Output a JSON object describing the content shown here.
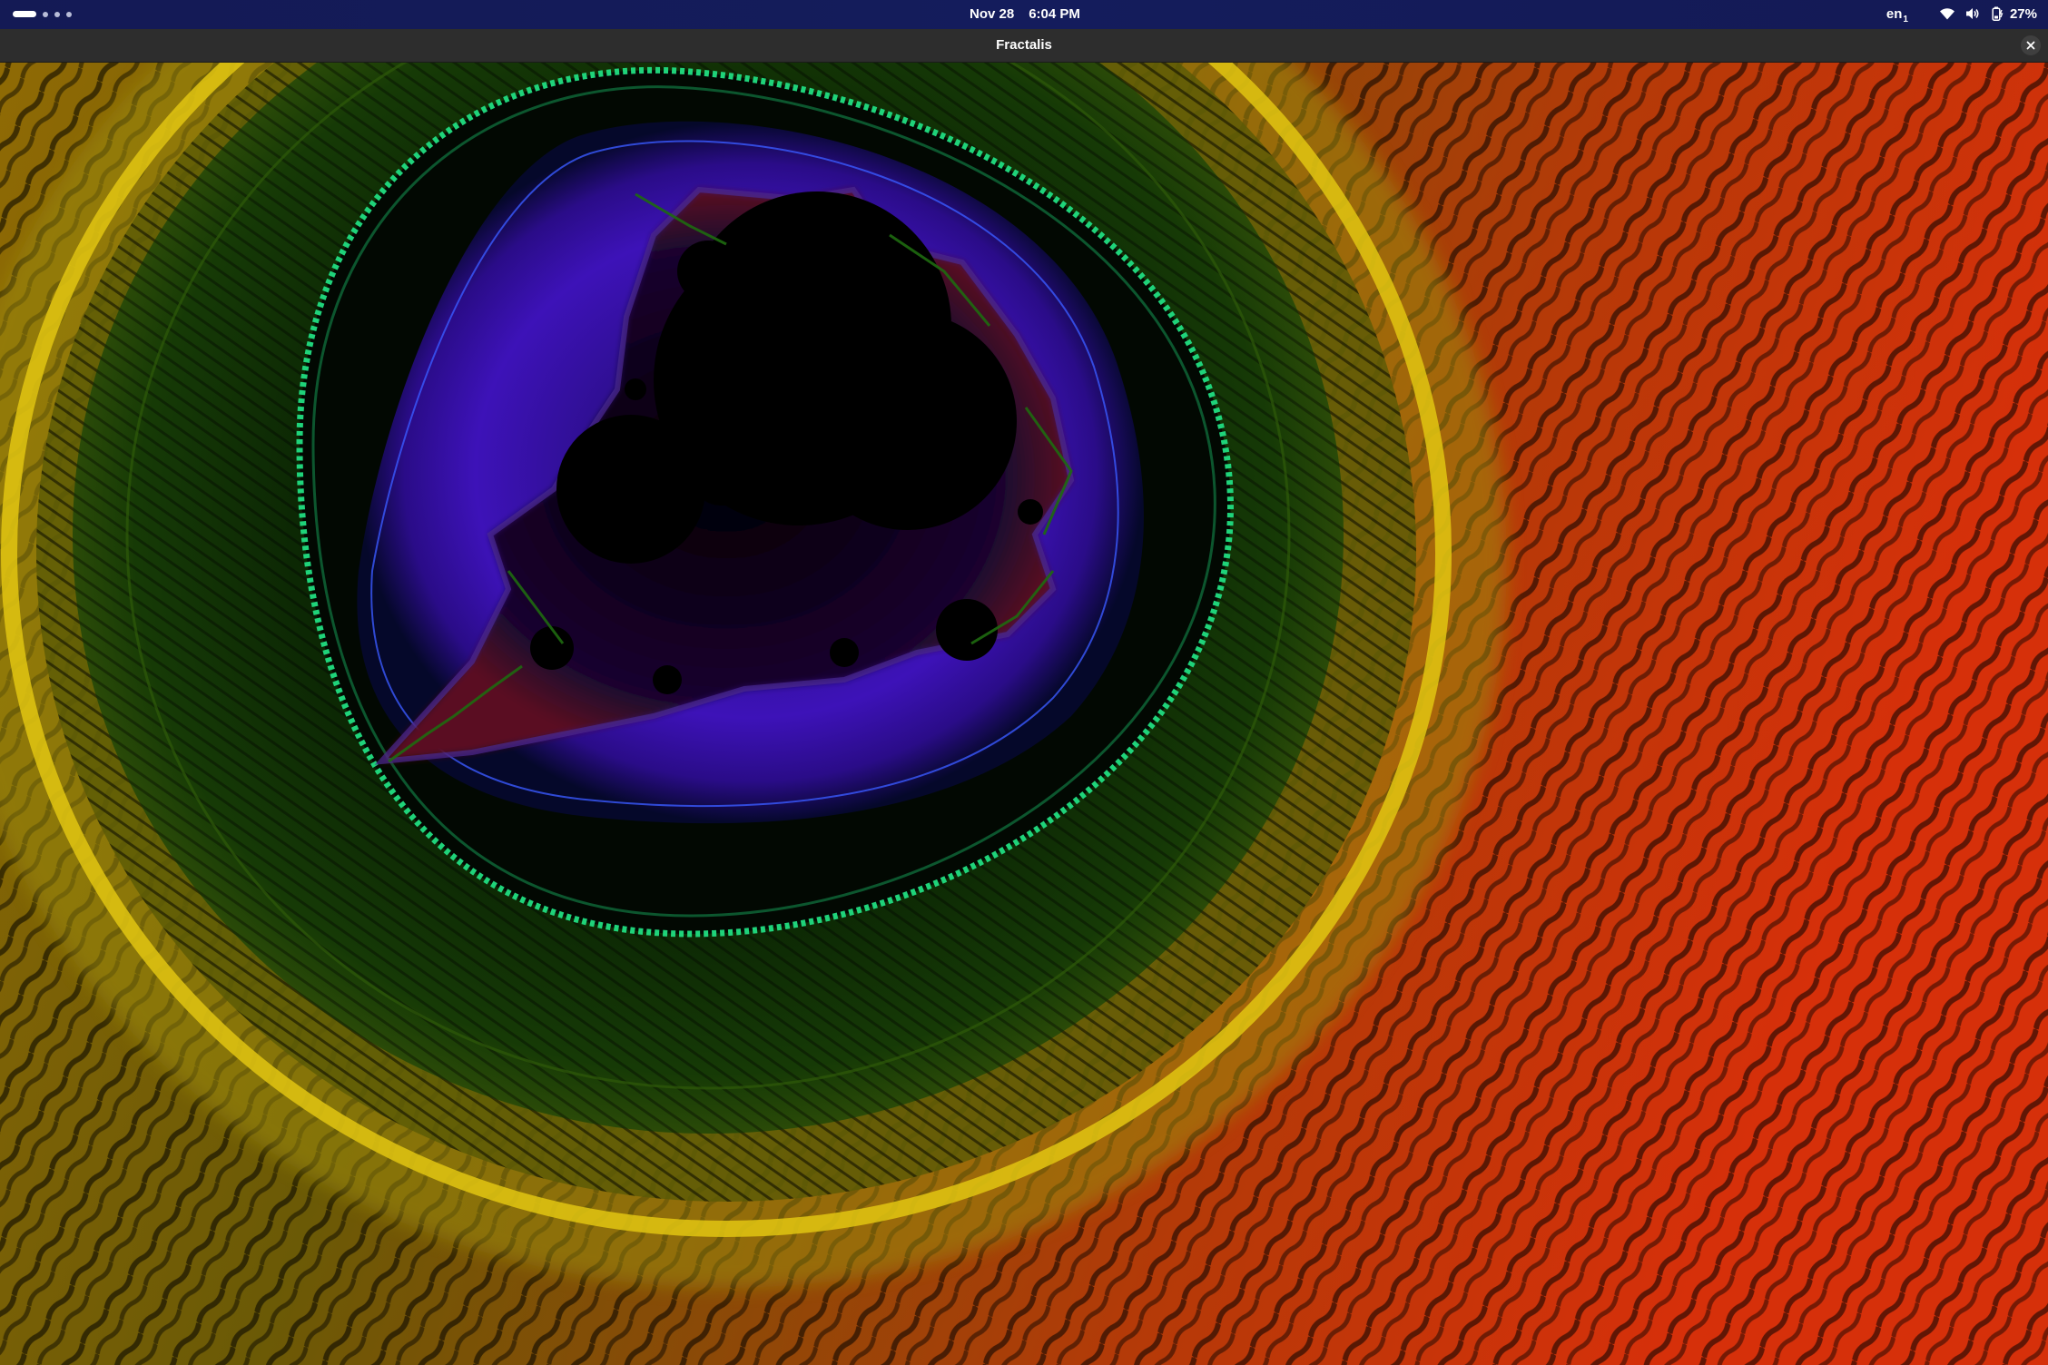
{
  "topbar": {
    "date": "Nov 28",
    "time": "6:04 PM",
    "language": "en",
    "language_sub": "1",
    "battery_percent": "27%",
    "workspace_count": 4,
    "active_workspace": 1,
    "icons": [
      "wifi-icon",
      "volume-icon",
      "battery-icon"
    ]
  },
  "window": {
    "title": "Fractalis",
    "close_icon": "close-icon"
  },
  "fractal": {
    "type": "mandelbrot",
    "palette": {
      "interior": "#000000",
      "halo_blue": "#3a14b8",
      "green_ring": "#1fd37a",
      "dark_green": "#0c2a05",
      "yellow_ring": "#e2c512",
      "orange": "#f07a1a",
      "red": "#ff2a10"
    }
  }
}
